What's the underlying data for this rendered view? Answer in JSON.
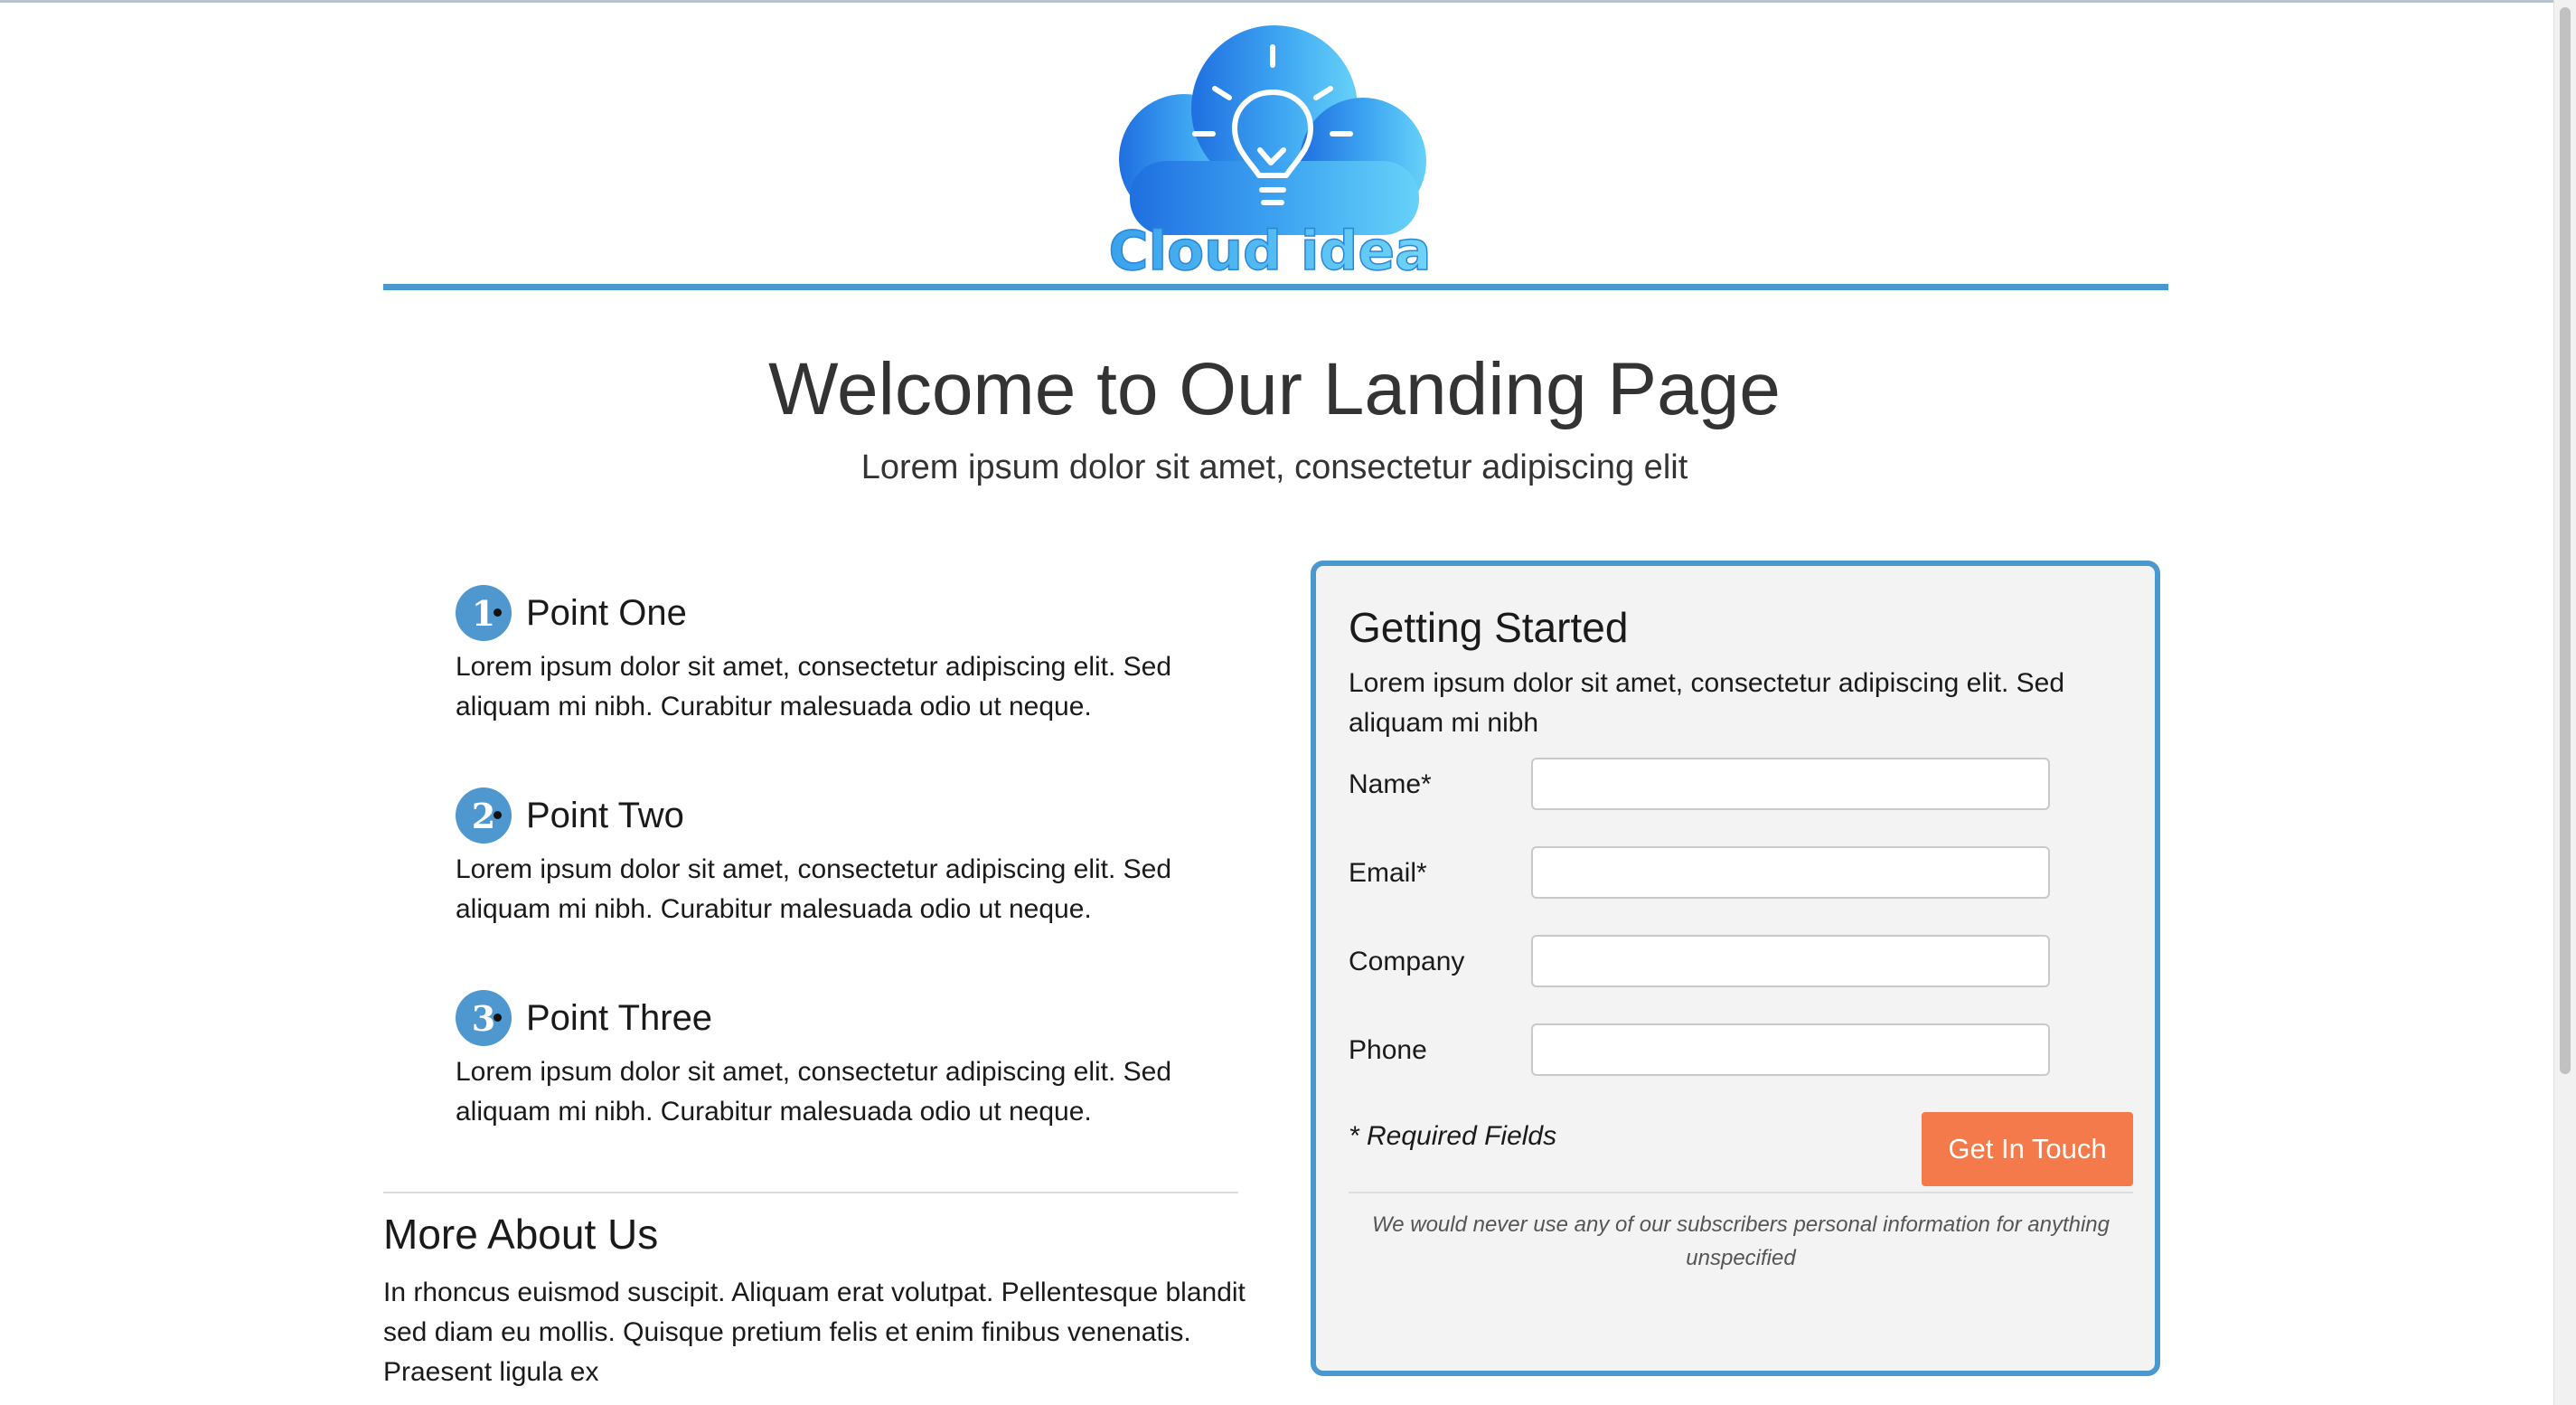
{
  "logo": {
    "text": "Cloud idea",
    "icon": "cloud-lightbulb-logo"
  },
  "hero": {
    "title": "Welcome to Our Landing Page",
    "subtitle": "Lorem ipsum dolor sit amet, consectetur adipiscing elit"
  },
  "points": [
    {
      "number": "1",
      "title": "Point One",
      "text": "Lorem ipsum dolor sit amet, consectetur adipiscing elit. Sed aliquam mi nibh. Curabitur malesuada odio ut neque."
    },
    {
      "number": "2",
      "title": "Point Two",
      "text": "Lorem ipsum dolor sit amet, consectetur adipiscing elit. Sed aliquam mi nibh. Curabitur malesuada odio ut neque."
    },
    {
      "number": "3",
      "title": "Point Three",
      "text": "Lorem ipsum dolor sit amet, consectetur adipiscing elit. Sed aliquam mi nibh. Curabitur malesuada odio ut neque."
    }
  ],
  "about": {
    "title": "More About Us",
    "text": "In rhoncus euismod suscipit. Aliquam erat volutpat. Pellentesque blandit sed diam eu mollis. Quisque pretium felis et enim finibus venenatis. Praesent ligula ex"
  },
  "form": {
    "title": "Getting Started",
    "description": "Lorem ipsum dolor sit amet, consectetur adipiscing elit. Sed aliquam mi nibh",
    "fields": [
      {
        "label": "Name*",
        "value": ""
      },
      {
        "label": "Email*",
        "value": ""
      },
      {
        "label": "Company",
        "value": ""
      },
      {
        "label": "Phone",
        "value": ""
      }
    ],
    "required_note": "* Required Fields",
    "submit_label": "Get In Touch",
    "privacy_note": "We would never use any of our subscribers personal information for anything unspecified"
  },
  "colors": {
    "accent_blue": "#4a98d0",
    "button_orange": "#f47a4b",
    "form_background": "#f3f3f3"
  }
}
